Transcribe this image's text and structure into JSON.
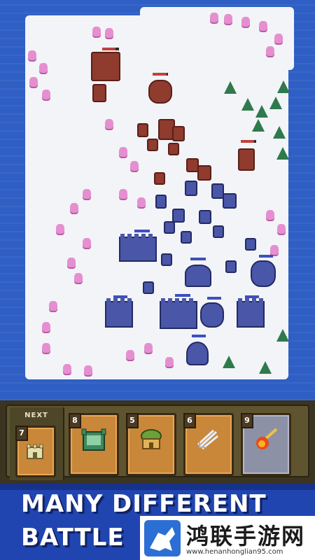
{
  "tray": {
    "next_label": "NEXT",
    "next_card": {
      "cost": "7",
      "icon": "castle-icon"
    },
    "cards": [
      {
        "cost": "8",
        "icon": "fortress-icon",
        "style": "orange"
      },
      {
        "cost": "5",
        "icon": "hut-icon",
        "style": "orange"
      },
      {
        "cost": "6",
        "icon": "arrows-icon",
        "style": "orange"
      },
      {
        "cost": "9",
        "icon": "fireball-icon",
        "style": "gray"
      }
    ]
  },
  "banner": {
    "line1": "MANY DIFFERENT",
    "line2": "BATTLE"
  },
  "watermark": {
    "title": "鸿联手游网",
    "url": "www.henanhonglian95.com",
    "logo": "horse-logo-icon"
  },
  "colors": {
    "sea": "#2f5fc4",
    "snow": "#f2f4f8",
    "red_team": "#8f3b2e",
    "blue_team": "#4a57a8"
  }
}
